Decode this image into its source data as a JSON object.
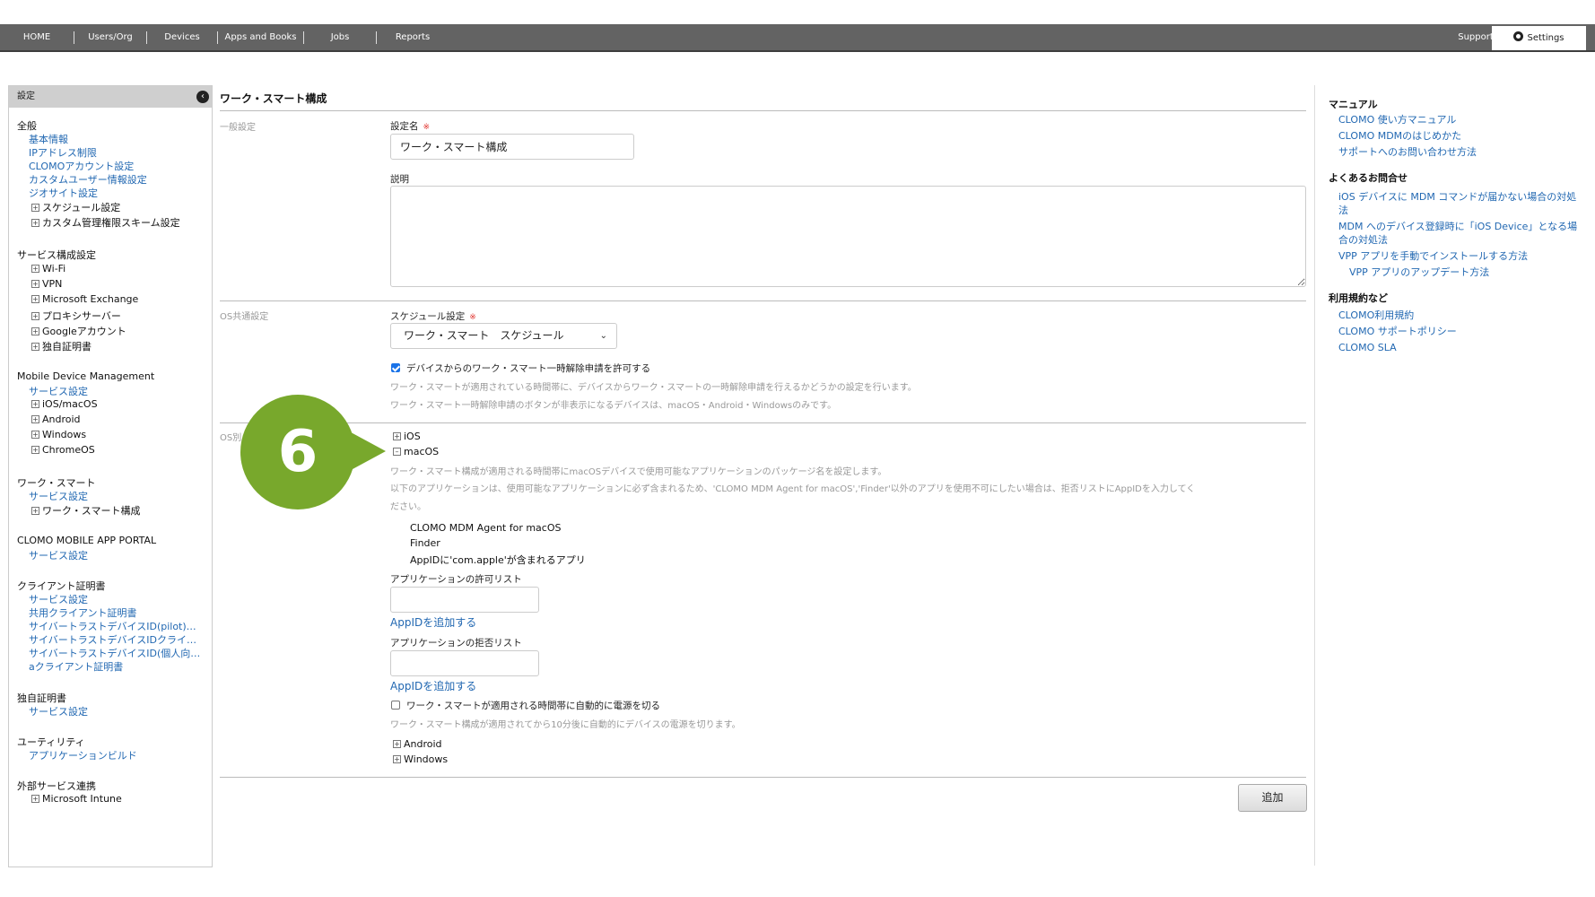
{
  "nav": {
    "items": [
      "HOME",
      "Users/Org",
      "Devices",
      "Apps and Books",
      "Jobs",
      "Reports"
    ],
    "support": "Support",
    "settings": "Settings"
  },
  "sidebar": {
    "header": "設定",
    "general": {
      "title": "全般",
      "links": [
        "基本情報",
        "IPアドレス制限",
        "CLOMOアカウント設定",
        "カスタムユーザー情報設定",
        "ジオサイト設定"
      ],
      "tree": [
        "スケジュール設定",
        "カスタム管理権限スキーム設定"
      ]
    },
    "service": {
      "title": "サービス構成設定",
      "tree": [
        "Wi-Fi",
        "VPN",
        "Microsoft Exchange",
        "プロキシサーバー",
        "Googleアカウント",
        "独自証明書"
      ]
    },
    "mdm": {
      "title": "Mobile Device Management",
      "links": [
        "サービス設定"
      ],
      "tree": [
        "iOS/macOS",
        "Android",
        "Windows",
        "ChromeOS"
      ]
    },
    "worksmart": {
      "title": "ワーク・スマート",
      "links": [
        "サービス設定"
      ],
      "tree": [
        "ワーク・スマート構成"
      ]
    },
    "portal": {
      "title": "CLOMO MOBILE APP PORTAL",
      "links": [
        "サービス設定"
      ]
    },
    "client_cert": {
      "title": "クライアント証明書",
      "links": [
        "サービス設定",
        "共用クライアント証明書",
        "サイバートラストデバイスID(pilot)…",
        "サイバートラストデバイスIDクライ…",
        "サイバートラストデバイスID(個人向…",
        "aクライアント証明書"
      ]
    },
    "own_cert": {
      "title": "独自証明書",
      "links": [
        "サービス設定"
      ]
    },
    "utility": {
      "title": "ユーティリティ",
      "links": [
        "アプリケーションビルド"
      ]
    },
    "external": {
      "title": "外部サービス連携",
      "tree": [
        "Microsoft Intune"
      ]
    }
  },
  "main": {
    "title": "ワーク・スマート構成",
    "general_label": "一般設定",
    "name_label": "設定名",
    "required_mark": "※",
    "name_value": "ワーク・スマート構成",
    "desc_label": "説明",
    "os_common_label": "OS共通設定",
    "schedule_label": "スケジュール設定",
    "schedule_value": "ワーク・スマート　スケジュール",
    "allow_release_label": "デバイスからのワーク・スマート一時解除申請を許可する",
    "allow_release_desc1": "ワーク・スマートが適用されている時間帯に、デバイスからワーク・スマートの一時解除申請を行えるかどうかの設定を行います。",
    "allow_release_desc2": "ワーク・スマート一時解除申請のボタンが非表示になるデバイスは、macOS・Android・Windowsのみです。",
    "os_label": "OS別",
    "ios": "iOS",
    "macos": "macOS",
    "macos_desc1": "ワーク・スマート構成が適用される時間帯にmacOSデバイスで使用可能なアプリケーションのパッケージ名を設定します。",
    "macos_desc2": "以下のアプリケーションは、使用可能なアプリケーションに必ず含まれるため、'CLOMO MDM Agent for macOS','Finder'以外のアプリを使用不可にしたい場合は、拒否リストにAppIDを入力してく",
    "macos_desc3": "ださい。",
    "builtin_apps": [
      "CLOMO MDM Agent for macOS",
      "Finder",
      "AppIDに'com.apple'が含まれるアプリ"
    ],
    "allow_list_label": "アプリケーションの許可リスト",
    "add_appid": "AppIDを追加する",
    "deny_list_label": "アプリケーションの拒否リスト",
    "power_off_label": "ワーク・スマートが適用される時間帯に自動的に電源を切る",
    "power_off_desc": "ワーク・スマート構成が適用されてから10分後に自動的にデバイスの電源を切ります。",
    "android": "Android",
    "windows": "Windows",
    "add_button": "追加",
    "allow_release_checked": true,
    "power_off_checked": false
  },
  "callout": {
    "number": "6",
    "color": "#78a82c"
  },
  "rightpanel": {
    "manual_title": "マニュアル",
    "manual_links": [
      "CLOMO 使い方マニュアル",
      "CLOMO MDMのはじめかた",
      "サポートへのお問い合わせ方法"
    ],
    "faq_title": "よくあるお問合せ",
    "faq_links": [
      "iOS デバイスに MDM コマンドが届かない場合の対処法",
      "MDM へのデバイス登録時に「iOS Device」となる場合の対処法",
      "VPP アプリを手動でインストールする方法",
      "VPP アプリのアップデート方法"
    ],
    "terms_title": "利用規約など",
    "terms_links": [
      "CLOMO利用規約",
      "CLOMO サポートポリシー",
      "CLOMO SLA"
    ]
  }
}
